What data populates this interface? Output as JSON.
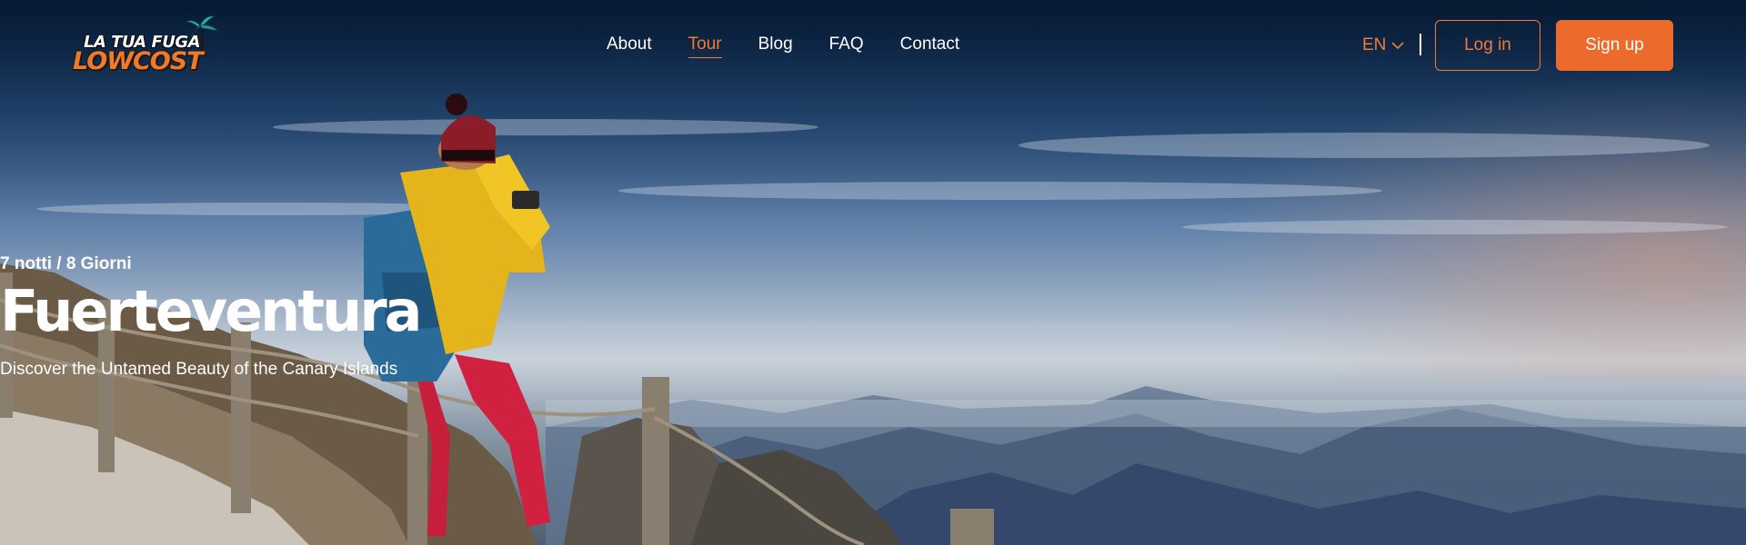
{
  "logo": {
    "line1": "LA TUA FUGA",
    "line2": "LOWCOST",
    "icon": "palm-tree-icon"
  },
  "nav": {
    "items": [
      {
        "label": "About",
        "active": false
      },
      {
        "label": "Tour",
        "active": true
      },
      {
        "label": "Blog",
        "active": false
      },
      {
        "label": "FAQ",
        "active": false
      },
      {
        "label": "Contact",
        "active": false
      }
    ]
  },
  "language": {
    "selected": "EN",
    "icon": "chevron-down-icon"
  },
  "auth": {
    "login_label": "Log in",
    "signup_label": "Sign up"
  },
  "hero": {
    "duration": "7 notti / 8 Giorni",
    "title": "Fuerteventura",
    "tagline": "Discover the Untamed Beauty of the Canary Islands"
  },
  "colors": {
    "accent": "#ec6a2c",
    "nav_active": "#ef7a3a",
    "text": "#ffffff",
    "header_bg": "#04162d"
  }
}
